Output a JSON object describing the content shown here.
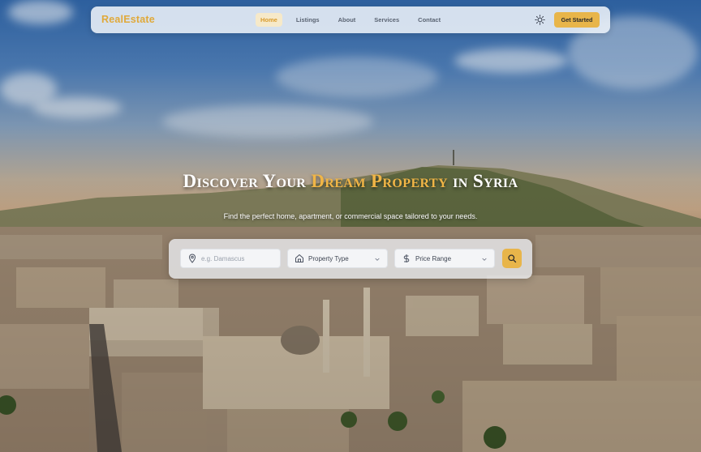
{
  "nav": {
    "logo": "RealEstate",
    "links": [
      {
        "label": "Home",
        "active": true
      },
      {
        "label": "Listings",
        "active": false
      },
      {
        "label": "About",
        "active": false
      },
      {
        "label": "Services",
        "active": false
      },
      {
        "label": "Contact",
        "active": false
      }
    ],
    "theme_toggle_icon": "sun-icon",
    "cta_label": "Get Started"
  },
  "hero": {
    "title_part1": "Discover Your ",
    "title_accent": "Dream Property",
    "title_part2": " in Syria",
    "subtitle": "Find the perfect home, apartment, or commercial space tailored to your needs."
  },
  "search": {
    "location_placeholder": "e.g. Damascus",
    "property_type_label": "Property Type",
    "price_range_label": "Price Range",
    "search_icon": "search-icon"
  },
  "colors": {
    "accent": "#e8b54a",
    "logo": "#e0a93a",
    "active_tab_bg": "#f6e9c9"
  }
}
